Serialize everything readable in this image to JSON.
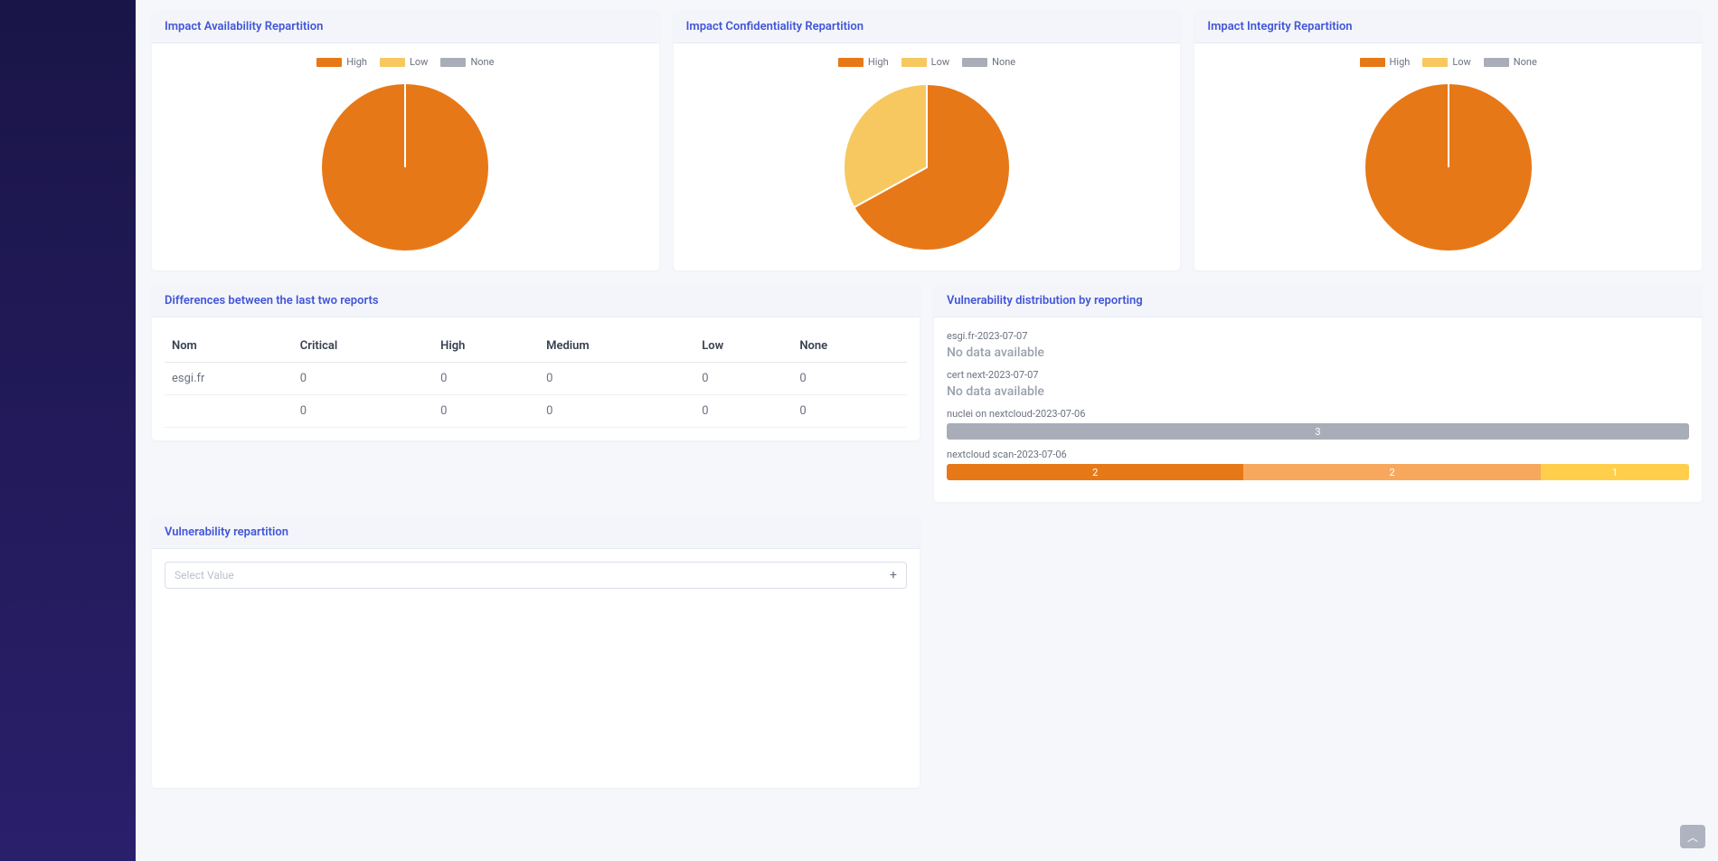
{
  "colors": {
    "high": "#e77817",
    "low": "#f6c85f",
    "none": "#a8adb8",
    "segLow": "#f8a85c",
    "segNone": "#ffcf4c"
  },
  "legend": {
    "high": "High",
    "low": "Low",
    "none": "None"
  },
  "charts": [
    {
      "title": "Impact Availability Repartition"
    },
    {
      "title": "Impact Confidentiality Repartition"
    },
    {
      "title": "Impact Integrity Repartition"
    }
  ],
  "chart_data": [
    {
      "type": "pie",
      "title": "Impact Availability Repartition",
      "series": [
        {
          "name": "High",
          "value": 100,
          "color": "#e77817"
        },
        {
          "name": "Low",
          "value": 0,
          "color": "#f6c85f"
        },
        {
          "name": "None",
          "value": 0,
          "color": "#a8adb8"
        }
      ]
    },
    {
      "type": "pie",
      "title": "Impact Confidentiality Repartition",
      "series": [
        {
          "name": "High",
          "value": 67,
          "color": "#e77817"
        },
        {
          "name": "Low",
          "value": 33,
          "color": "#f6c85f"
        },
        {
          "name": "None",
          "value": 0,
          "color": "#a8adb8"
        }
      ]
    },
    {
      "type": "pie",
      "title": "Impact Integrity Repartition",
      "series": [
        {
          "name": "High",
          "value": 100,
          "color": "#e77817"
        },
        {
          "name": "Low",
          "value": 0,
          "color": "#f6c85f"
        },
        {
          "name": "None",
          "value": 0,
          "color": "#a8adb8"
        }
      ]
    }
  ],
  "diff": {
    "title": "Differences between the last two reports",
    "columns": [
      "Nom",
      "Critical",
      "High",
      "Medium",
      "Low",
      "None"
    ],
    "rows": [
      [
        "esgi.fr",
        "0",
        "0",
        "0",
        "0",
        "0"
      ],
      [
        "",
        "0",
        "0",
        "0",
        "0",
        "0"
      ]
    ]
  },
  "distribution": {
    "title": "Vulnerability distribution by reporting",
    "no_data_text": "No data available",
    "entries": [
      {
        "label": "esgi.fr-2023-07-07",
        "no_data": true
      },
      {
        "label": "cert next-2023-07-07",
        "no_data": true
      },
      {
        "label": "nuclei on nextcloud-2023-07-06",
        "segments": [
          {
            "value": 3,
            "color": "#a8adb8"
          }
        ]
      },
      {
        "label": "nextcloud scan-2023-07-06",
        "segments": [
          {
            "value": 2,
            "color": "#e77817"
          },
          {
            "value": 2,
            "color": "#f8a85c"
          },
          {
            "value": 1,
            "color": "#ffcf4c"
          }
        ]
      }
    ]
  },
  "repartition": {
    "title": "Vulnerability repartition",
    "select_placeholder": "Select Value"
  }
}
